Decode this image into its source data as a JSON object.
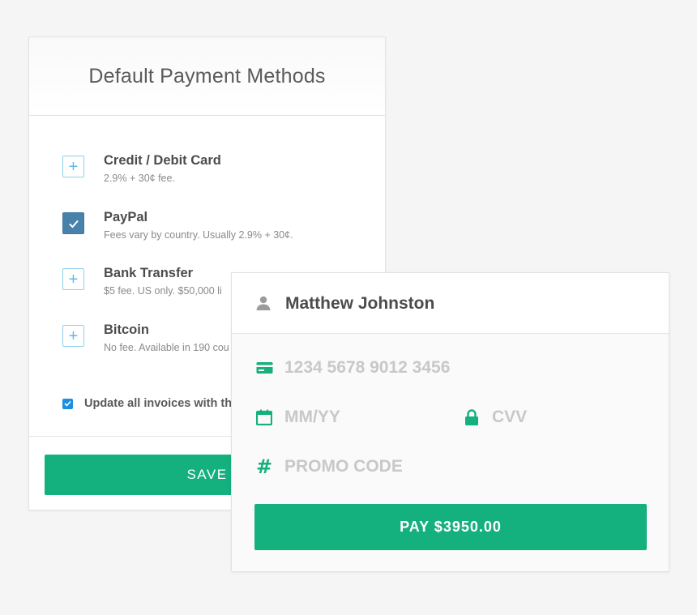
{
  "payment_methods": {
    "title": "Default Payment Methods",
    "items": [
      {
        "name": "Credit / Debit Card",
        "description": "2.9% + 30¢ fee.",
        "checked": false,
        "icon": "plus-icon"
      },
      {
        "name": "PayPal",
        "description": "Fees vary by country. Usually 2.9% + 30¢.",
        "checked": true,
        "icon": "check-icon"
      },
      {
        "name": "Bank Transfer",
        "description": "$5 fee. US only. $50,000 li",
        "checked": false,
        "icon": "plus-icon"
      },
      {
        "name": "Bitcoin",
        "description": "No fee. Available in 190 cou",
        "checked": false,
        "icon": "plus-icon"
      }
    ],
    "update_label": "Update all invoices with th",
    "update_checked": true,
    "save_label": "SAVE"
  },
  "pay_form": {
    "user_name": "Matthew Johnston",
    "card_number_placeholder": "1234 5678 9012 3456",
    "expiry_placeholder": "MM/YY",
    "cvv_placeholder": "CVV",
    "promo_placeholder": "PROMO CODE",
    "pay_label": "PAY $3950.00"
  },
  "colors": {
    "accent_green": "#14b07e",
    "checkbox_blue": "#4882aa",
    "small_check_blue": "#1c8fe3",
    "plus_outline": "#8fd0ee"
  }
}
